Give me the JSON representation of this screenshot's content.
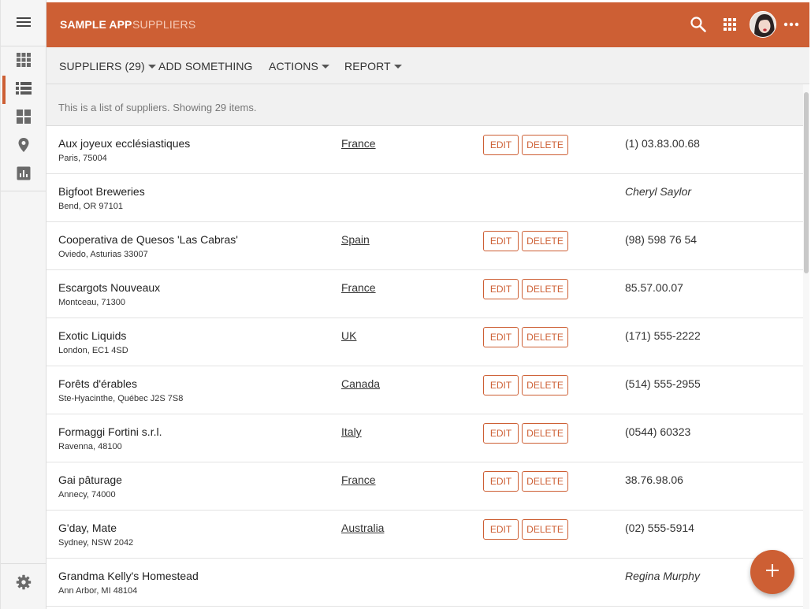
{
  "app": {
    "name": "SAMPLE APP",
    "section": "SUPPLIERS"
  },
  "colors": {
    "accent": "#cd5f34"
  },
  "icons": {
    "menu": "menu-icon",
    "nav": [
      "grid-icon",
      "list-icon",
      "dashboard-icon",
      "map-pin-icon",
      "bar-chart-icon"
    ],
    "settings": "gear-icon",
    "search": "search-icon",
    "apps": "apps-icon",
    "more": "more-horizontal-icon",
    "fab": "plus-icon"
  },
  "toolbar": {
    "suppliers": "SUPPLIERS (29)",
    "add": "ADD SOMETHING",
    "actions": "ACTIONS",
    "report": "REPORT"
  },
  "summary": "This is a list of suppliers. Showing 29 items.",
  "buttons": {
    "edit": "EDIT",
    "delete": "DELETE"
  },
  "rows": [
    {
      "name": "Aux joyeux ecclésiastiques",
      "address": "Paris, 75004",
      "country": "France",
      "info": "(1) 03.83.00.68"
    },
    {
      "name": "Bigfoot Breweries",
      "address": "Bend, OR 97101",
      "country": "",
      "info": "Cheryl Saylor"
    },
    {
      "name": "Cooperativa de Quesos 'Las Cabras'",
      "address": "Oviedo, Asturias 33007",
      "country": "Spain",
      "info": "(98) 598 76 54"
    },
    {
      "name": "Escargots Nouveaux",
      "address": "Montceau, 71300",
      "country": "France",
      "info": "85.57.00.07"
    },
    {
      "name": "Exotic Liquids",
      "address": "London, EC1 4SD",
      "country": "UK",
      "info": "(171) 555-2222"
    },
    {
      "name": "Forêts d'érables",
      "address": "Ste-Hyacinthe, Québec J2S 7S8",
      "country": "Canada",
      "info": "(514) 555-2955"
    },
    {
      "name": "Formaggi Fortini s.r.l.",
      "address": "Ravenna, 48100",
      "country": "Italy",
      "info": "(0544) 60323"
    },
    {
      "name": "Gai pâturage",
      "address": "Annecy, 74000",
      "country": "France",
      "info": "38.76.98.06"
    },
    {
      "name": "G'day, Mate",
      "address": "Sydney, NSW 2042",
      "country": "Australia",
      "info": "(02) 555-5914"
    },
    {
      "name": "Grandma Kelly's Homestead",
      "address": "Ann Arbor, MI 48104",
      "country": "",
      "info": "Regina Murphy"
    }
  ]
}
